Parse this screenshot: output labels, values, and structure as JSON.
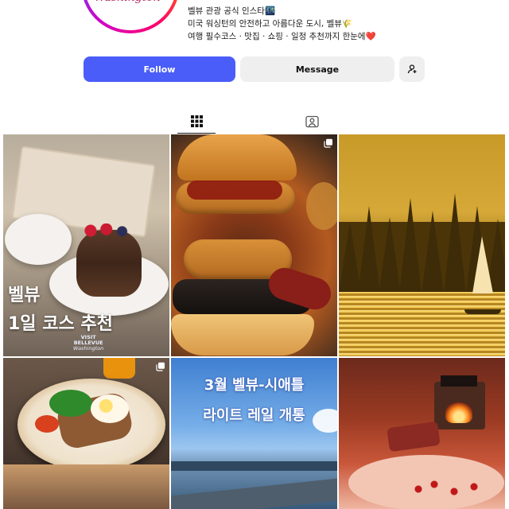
{
  "profile": {
    "avatar_label": "Washington",
    "bio": [
      "벨뷰 관광 공식 인스타🌃",
      "미국 워싱턴의 안전하고 아름다운 도시, 벨뷰🌾",
      "여행 필수코스 · 맛집 · 쇼핑 · 일정 추천까지 한눈에❤️"
    ]
  },
  "actions": {
    "follow": "Follow",
    "message": "Message"
  },
  "tabs": [
    {
      "icon": "grid-icon",
      "active": true
    },
    {
      "icon": "tagged-icon",
      "active": false
    }
  ],
  "posts": [
    {
      "id": "post-1",
      "title": "벨뷰",
      "subtitle": "1일 코스 추천",
      "brand": [
        "VISIT",
        "BELLEVUE",
        "Washington"
      ],
      "multi": false
    },
    {
      "id": "post-2",
      "multi": true
    },
    {
      "id": "post-3",
      "multi": false
    },
    {
      "id": "post-4",
      "multi": true
    },
    {
      "id": "post-5",
      "line1": "3월 벨뷰-시애틀",
      "line2": "라이트 레일 개통",
      "multi": false
    },
    {
      "id": "post-6",
      "multi": false
    }
  ],
  "colors": {
    "follow_bg": "#4a5df9",
    "secondary_bg": "#efefef"
  }
}
